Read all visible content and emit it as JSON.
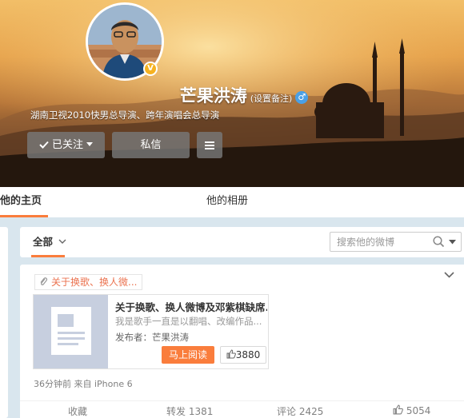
{
  "profile": {
    "name": "芒果洪涛",
    "remark": "(设置备注)",
    "gender_symbol": "♂",
    "verified_badge": "V",
    "description": "湖南卫视2010快男总导演、跨年演唱会总导演"
  },
  "actions": {
    "follow_label": "已关注",
    "message_label": "私信"
  },
  "tabs": [
    {
      "label": "他的主页",
      "active": true
    },
    {
      "label": "他的相册",
      "active": false
    }
  ],
  "filter": {
    "all_label": "全部",
    "search_placeholder": "搜索他的微博"
  },
  "post": {
    "topic_tag": "关于换歌、换人微...",
    "article": {
      "title": "关于换歌、换人微博及邓紫棋缺席...",
      "summary": "我是歌手一直是以翻唱、改编作品...",
      "publisher": "发布者：芒果洪涛",
      "read_label": "马上阅读",
      "likes": "3880"
    },
    "meta": "36分钟前 来自 iPhone 6",
    "favorite_label": "收藏",
    "repost_label": "转发 1381",
    "comment_label": "评论 2425",
    "like_count": "5054"
  },
  "colors": {
    "accent": "#fa7d3c",
    "tag_text": "#eb7350",
    "gender_blue": "#4aa0e6",
    "badge_gold": "#f6b221"
  },
  "icons": [
    "checkmark-icon",
    "caret-down-icon",
    "menu-icon",
    "search-icon",
    "paperclip-icon",
    "chevron-down-icon",
    "thumbs-up-icon",
    "document-icon"
  ]
}
